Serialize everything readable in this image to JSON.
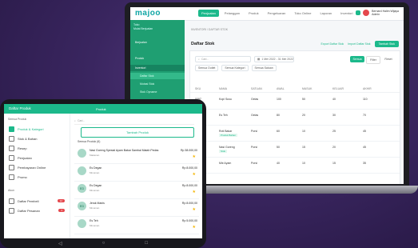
{
  "laptop": {
    "logo": "majoo",
    "nav": [
      "Penjualan",
      "Pelanggan",
      "Produk",
      "Pengeluaran",
      "Toko Online",
      "Laporan",
      "Inventori"
    ],
    "user": {
      "name": "Bernard Halim Wijaya",
      "role": "Admin"
    },
    "sidebar": {
      "top": [
        "Toko",
        "Mulai Berjualan"
      ],
      "items": [
        "Berjualan",
        "Produk",
        "Inventori",
        "Daftar Stok",
        "Mutasi Stok",
        "Stok Opname"
      ]
    },
    "breadcrumb": "INVENTORI / DAFTAR STOK",
    "page_title": "Daftar Stok",
    "actions": {
      "link1": "Export Daftar Stok",
      "link2": "Import Daftar Stok",
      "button": "Tambah Stok"
    },
    "search_placeholder": "Cari...",
    "date_range": "1 Mei 2022 - 31 Mei 2022",
    "toggles": [
      "Semua",
      "Filter",
      "Reset"
    ],
    "filters": [
      "Semua Outlet",
      "Semua Kategori",
      "Semua Satuan"
    ],
    "columns": [
      "SKU",
      "NAMA",
      "SATUAN",
      "AWAL",
      "MASUK",
      "KELUAR",
      "AKHIR"
    ],
    "rows": [
      {
        "sku": "0097",
        "name": "Kopi Susu",
        "unit": "Gelas",
        "a": "100",
        "b": "50",
        "c": "40",
        "d": "110"
      },
      {
        "sku": "0098",
        "name": "Es Teh",
        "unit": "Gelas",
        "a": "80",
        "b": "20",
        "c": "30",
        "d": "70"
      },
      {
        "sku": "0099",
        "name": "Roti Bakar",
        "unit": "Porsi",
        "a": "60",
        "b": "10",
        "c": "25",
        "d": "45",
        "tag": "Produk Bahan"
      },
      {
        "sku": "0100",
        "name": "Nasi Goreng",
        "unit": "Porsi",
        "a": "50",
        "b": "15",
        "c": "20",
        "d": "45",
        "tag": "Stok"
      },
      {
        "sku": "0101",
        "name": "Mie Ayam",
        "unit": "Porsi",
        "a": "40",
        "b": "10",
        "c": "15",
        "d": "35"
      }
    ]
  },
  "tablet": {
    "title": "Daftar Produk",
    "center": "Produk",
    "sidebar_head": "Semua Produk",
    "sidebar_items": [
      {
        "label": "Produk & Kategori",
        "active": true
      },
      {
        "label": "Stok & Bahan",
        "active": false
      },
      {
        "label": "Resep",
        "active": false
      },
      {
        "label": "Penjualan",
        "active": false
      },
      {
        "label": "Pembayaran Online",
        "active": false
      },
      {
        "label": "Promo",
        "active": false
      }
    ],
    "sidebar_section": "Akun",
    "sidebar_extra": [
      {
        "label": "Daftar Pembeli",
        "badge": "12"
      },
      {
        "label": "Daftar Pesanan",
        "badge": "3"
      }
    ],
    "search_placeholder": "Cari...",
    "add_button": "Tambah Produk",
    "all_label": "Semua Produk (6)",
    "products": [
      {
        "thumb": "",
        "name": "Nasi Goreng Spesial Ayam Bakar Sambal Matah Pedas",
        "sub": "Makanan",
        "price": "Rp 38.000,00"
      },
      {
        "thumb": "",
        "name": "Es Degan",
        "sub": "Minuman",
        "price": "Rp 8.000,00"
      },
      {
        "thumb": "ED",
        "name": "Es Degan",
        "sub": "Minuman",
        "price": "Rp 8.000,00"
      },
      {
        "thumb": "ED",
        "name": "Jeruk Manis",
        "sub": "Minuman",
        "price": "Rp 8.000,00"
      },
      {
        "thumb": "",
        "name": "Es Teh",
        "sub": "Minuman",
        "price": "Rp 5.000,00"
      }
    ]
  }
}
